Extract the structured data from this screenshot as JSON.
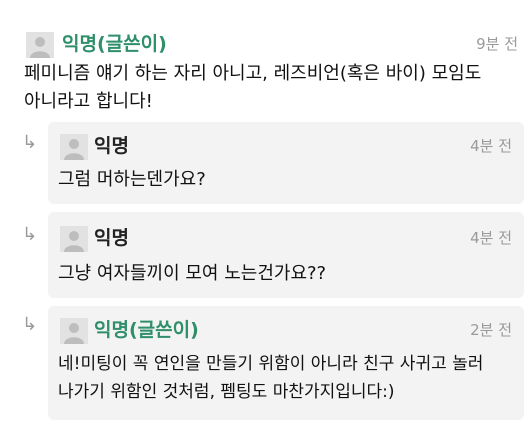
{
  "comments": [
    {
      "author": "익명(글쓴이)",
      "time": "9분 전",
      "text": "페미니즘 얘기 하는 자리 아니고, 레즈비언(혹은 바이) 모임도\n아니라고 합니다!"
    }
  ],
  "replies": [
    {
      "author": "익명",
      "time": "4분 전",
      "text": "그럼 머하는덴가요?"
    },
    {
      "author": "익명",
      "time": "4분 전",
      "text": "그냥 여자들끼이 모여 노는건가요??"
    },
    {
      "author": "익명(글쓴이)",
      "time": "2분 전",
      "text": "네!미팅이 꼭 연인을 만들기 위함이 아니라 친구 사귀고 놀러\n나가기 위함인 것처럼, 펨팅도 마찬가지입니다:)"
    }
  ],
  "icons": {
    "reply_arrow": "reply-arrow-icon",
    "avatar": "default-avatar-icon"
  },
  "colors": {
    "op_name": "#2f8f6b",
    "reply_bg": "#f3f3f3",
    "time": "#9a9a9a"
  }
}
